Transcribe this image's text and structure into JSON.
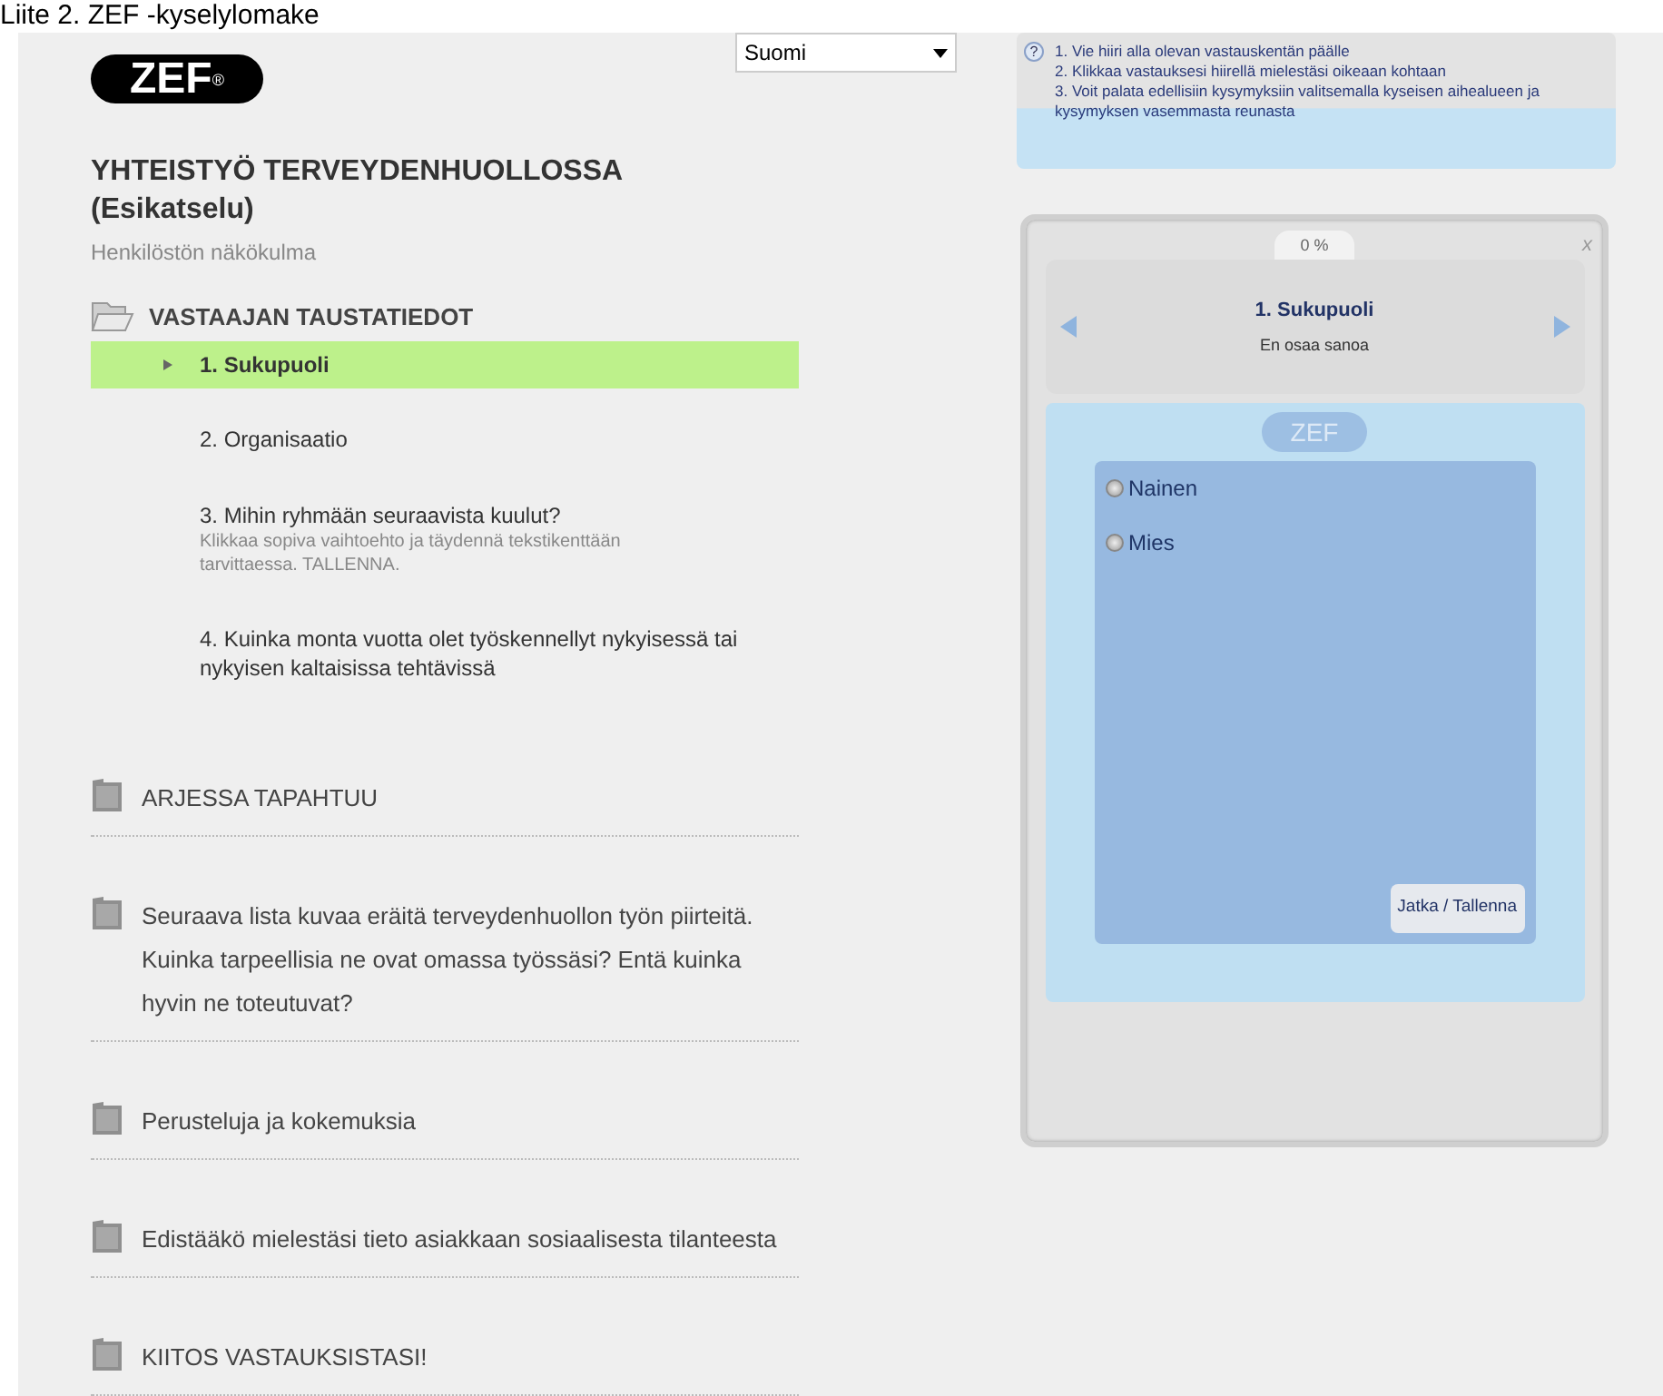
{
  "document_caption": "Liite 2. ZEF -kyselylomake",
  "logo": {
    "text": "ZEF",
    "mark": "®"
  },
  "language_select": {
    "value": "Suomi"
  },
  "help": {
    "icon": "?",
    "lines": [
      "1. Vie hiiri alla olevan vastauskentän päälle",
      "2. Klikkaa vastauksesi hiirellä mielestäsi oikeaan kohtaan",
      "3. Voit palata edellisiin kysymyksiin valitsemalla kyseisen aihealueen ja kysymyksen vasemmasta reunasta"
    ]
  },
  "survey": {
    "title": "YHTEISTYÖ TERVEYDENHUOLLOSSA",
    "preview": "(Esikatselu)",
    "subtitle": "Henkilöstön näkökulma"
  },
  "sections": [
    {
      "title": "VASTAAJAN TAUSTATIEDOT",
      "expanded": true,
      "questions": [
        {
          "text": "1. Sukupuoli",
          "selected": true
        },
        {
          "text": "2. Organisaatio",
          "selected": false
        },
        {
          "text": "3. Mihin ryhmään seuraavista kuulut?",
          "hint": "Klikkaa sopiva vaihtoehto ja täydennä tekstikenttään tarvittaessa. TALLENNA.",
          "selected": false
        },
        {
          "text": "4. Kuinka monta vuotta olet työskennellyt nykyisessä tai nykyisen kaltaisissa tehtävissä",
          "selected": false
        }
      ]
    },
    {
      "title": "ARJESSA TAPAHTUU",
      "expanded": false
    },
    {
      "title": "Seuraava lista kuvaa eräitä terveydenhuollon työn piirteitä. Kuinka tarpeellisia ne ovat omassa työssäsi? Entä kuinka hyvin ne toteutuvat?",
      "expanded": false
    },
    {
      "title": "Perusteluja ja kokemuksia",
      "expanded": false
    },
    {
      "title": "Edistääkö mielestäsi tieto asiakkaan sosiaalisesta tilanteesta",
      "expanded": false
    },
    {
      "title": "KIITOS VASTAUKSISTASI!",
      "expanded": false
    }
  ],
  "widget": {
    "progress": "0 %",
    "close": "x",
    "question": "1. Sukupuoli",
    "answer_status": "En osaa sanoa",
    "badge": "ZEF",
    "options": [
      {
        "label": "Nainen",
        "selected": false
      },
      {
        "label": "Mies",
        "selected": false
      }
    ],
    "submit": "Jatka / Tallenna"
  }
}
